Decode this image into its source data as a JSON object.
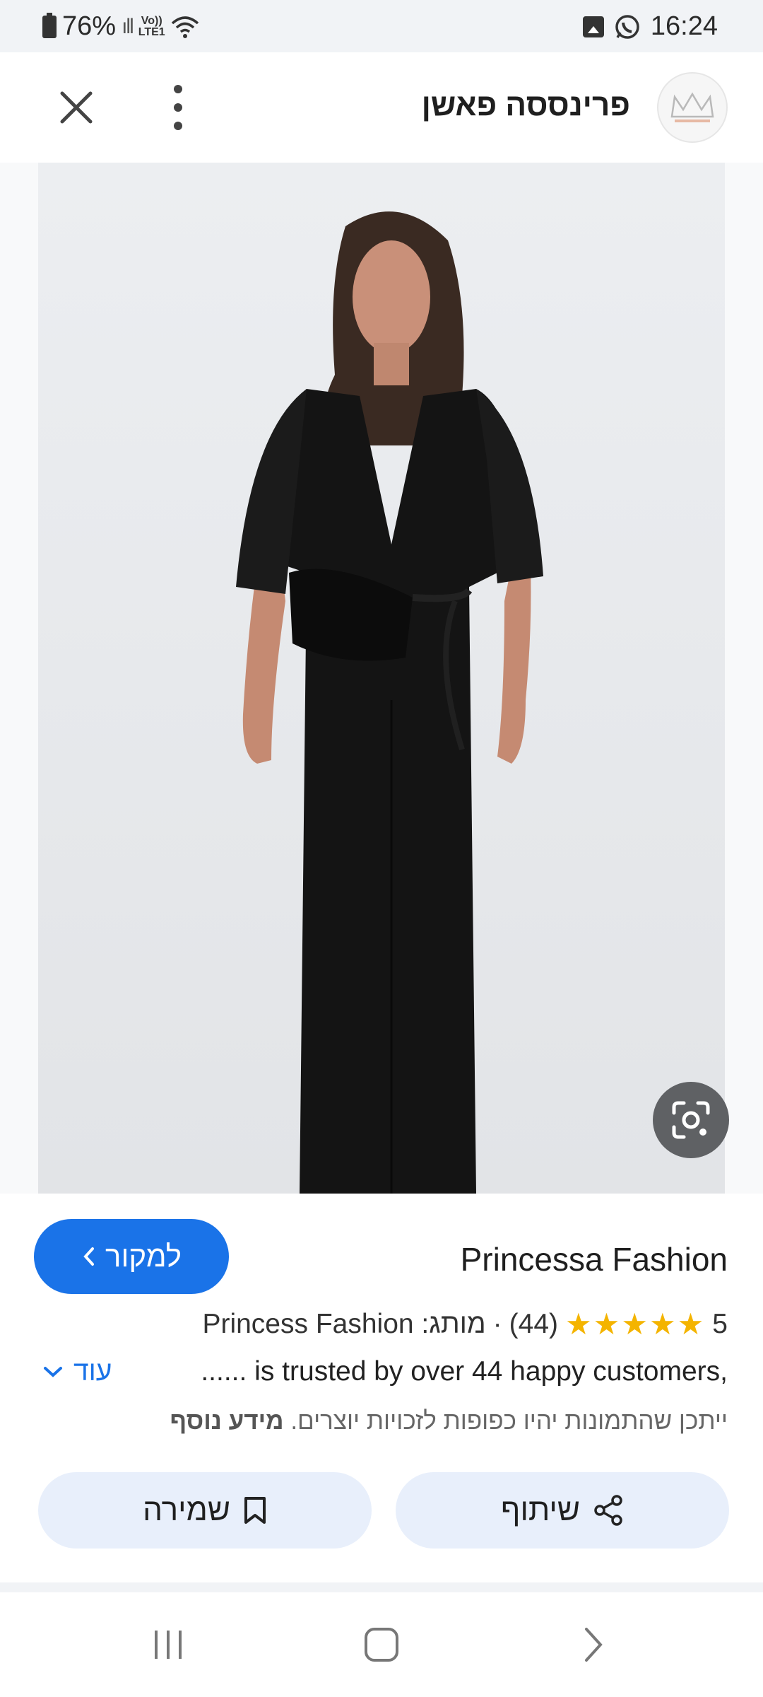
{
  "status_bar": {
    "battery": "76%",
    "network": "LTE1",
    "volte": "Vo))",
    "time": "16:24"
  },
  "header": {
    "title": "פרינססה פאשן",
    "close_icon": "close-icon",
    "more_icon": "more-vert-icon"
  },
  "image": {
    "alt": "Woman in black jumpsuit with belt bag",
    "lens_icon": "google-lens-icon"
  },
  "info": {
    "source_button": "למקור",
    "title": "Princessa Fashion",
    "rating_value": "5",
    "stars": "★★★★★",
    "review_count": "(44)",
    "separator": "·",
    "brand_line": "מותג: Princess Fashion",
    "description": "...... is trusted by over 44 happy customers,",
    "more_label": "עוד",
    "legal_text": "ייתכן שהתמונות יהיו כפופות לזכויות יוצרים.",
    "more_info": "מידע נוסף",
    "share_label": "שיתוף",
    "save_label": "שמירה"
  },
  "colors": {
    "accent": "#1a73e8",
    "star": "#f4b400",
    "pill_bg": "#e8effb"
  }
}
